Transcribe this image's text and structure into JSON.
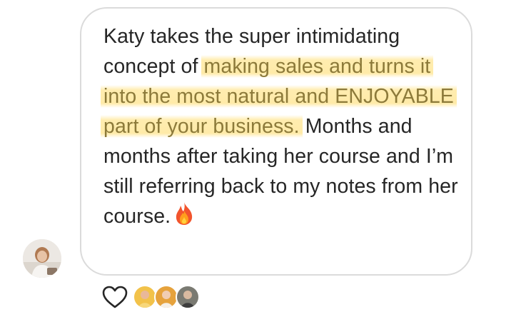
{
  "message": {
    "segments": [
      {
        "text": "Katy takes the super intimidating concept of ",
        "highlight": false
      },
      {
        "text": "making sales and turns  it into the most natural and ENJOYABLE part of your business.",
        "highlight": true
      },
      {
        "text": " Months and months after taking her course and I’m still referring back to my notes from her course.",
        "highlight": false
      }
    ],
    "emoji": "fire-emoji"
  },
  "colors": {
    "text": "#262626",
    "bubble_border": "#dbdbdb",
    "highlight": "#ffdd6e"
  },
  "icons": {
    "sender_avatar": "avatar-photo",
    "like": "heart-outline-icon",
    "reactors": [
      "reactor-avatar-yellow",
      "reactor-avatar-orange",
      "reactor-avatar-gray"
    ]
  }
}
